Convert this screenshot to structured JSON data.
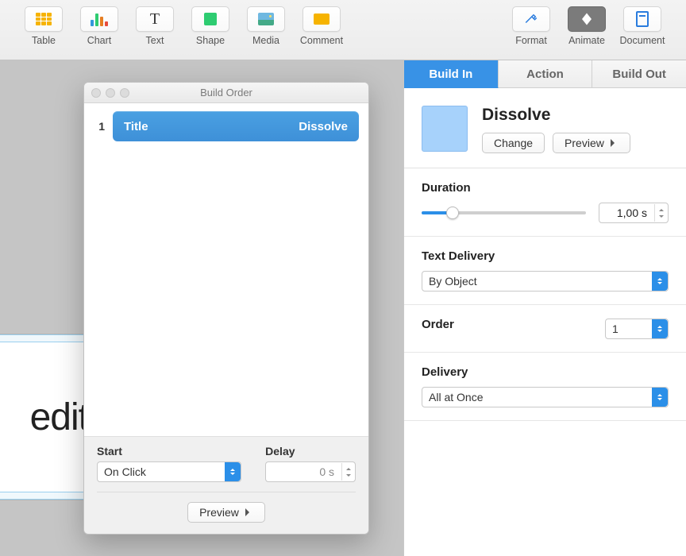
{
  "toolbar": {
    "left": [
      {
        "label": "Table"
      },
      {
        "label": "Chart"
      },
      {
        "label": "Text"
      },
      {
        "label": "Shape"
      },
      {
        "label": "Media"
      },
      {
        "label": "Comment"
      }
    ],
    "right": [
      {
        "label": "Format"
      },
      {
        "label": "Animate"
      },
      {
        "label": "Document"
      }
    ]
  },
  "build_window": {
    "title": "Build Order",
    "items": [
      {
        "index": "1",
        "name": "Title",
        "effect": "Dissolve"
      }
    ],
    "start_label": "Start",
    "start_value": "On Click",
    "delay_label": "Delay",
    "delay_value": "0 s",
    "preview_label": "Preview"
  },
  "slide": {
    "visible_text": "edit"
  },
  "inspector": {
    "tabs": {
      "build_in": "Build In",
      "action": "Action",
      "build_out": "Build Out"
    },
    "effect_name": "Dissolve",
    "change_label": "Change",
    "preview_label": "Preview",
    "duration": {
      "label": "Duration",
      "value": "1,00 s"
    },
    "text_delivery": {
      "label": "Text Delivery",
      "value": "By Object"
    },
    "order": {
      "label": "Order",
      "value": "1"
    },
    "delivery": {
      "label": "Delivery",
      "value": "All at Once"
    }
  }
}
